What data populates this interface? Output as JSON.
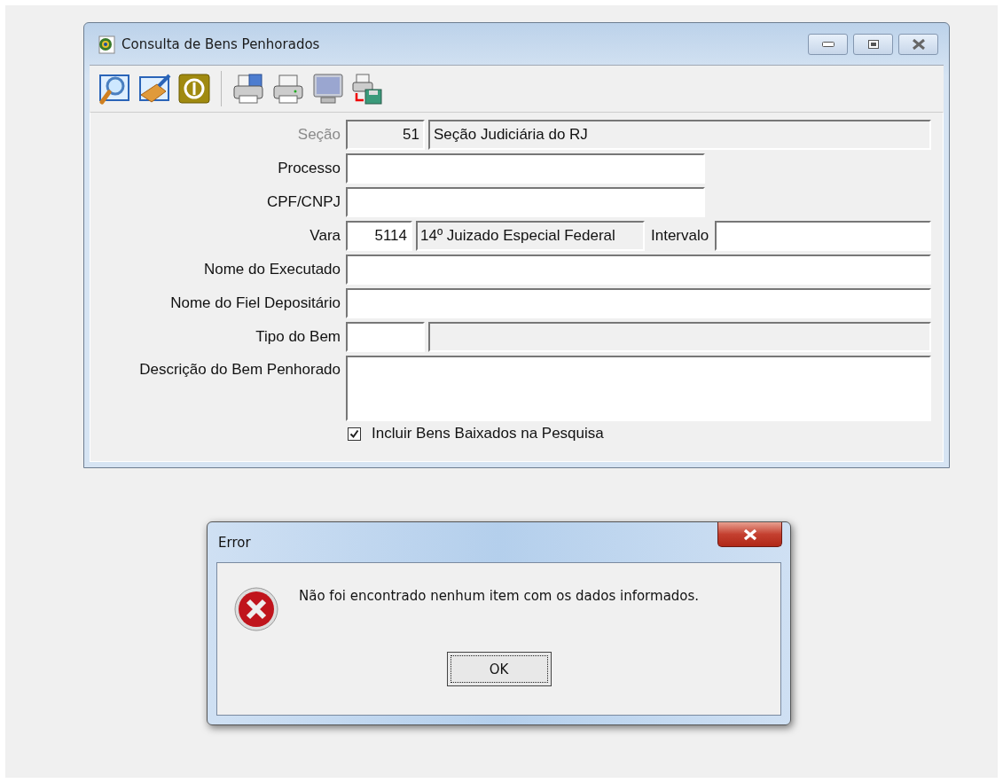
{
  "window": {
    "title": "Consulta de Bens Penhorados"
  },
  "form": {
    "fields": [
      {
        "kind": "lookup",
        "label": "Seção",
        "disabled": true,
        "code": "51",
        "description": "Seção Judiciária do RJ"
      },
      {
        "kind": "short",
        "label": "Processo",
        "disabled": false
      },
      {
        "kind": "short",
        "label": "CPF/CNPJ",
        "disabled": false
      },
      {
        "kind": "lookup_range",
        "label": "Vara",
        "disabled": false,
        "code": "5114",
        "description": "14º Juizado Especial Federal",
        "range_label": "Intervalo"
      },
      {
        "kind": "long",
        "label": "Nome do Executado",
        "disabled": false
      },
      {
        "kind": "long",
        "label": "Nome do Fiel Depositário",
        "disabled": false
      },
      {
        "kind": "lookup",
        "label": "Tipo do Bem",
        "disabled": false
      },
      {
        "kind": "memo",
        "label": "Descrição do Bem Penhorado",
        "disabled": false
      }
    ],
    "checkbox": {
      "label": "Incluir Bens Baixados na Pesquisa",
      "checked": true
    }
  },
  "dialog": {
    "title": "Error",
    "message": "Não foi encontrado nenhum item com os dados informados.",
    "button": "OK"
  }
}
